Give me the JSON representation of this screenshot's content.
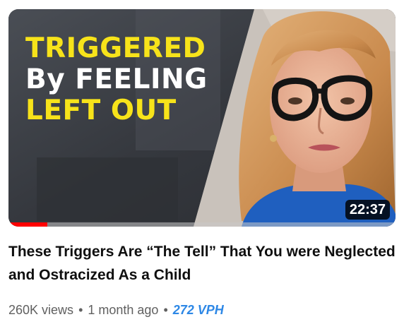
{
  "video": {
    "thumbnail_lines": [
      "TRIGGERED",
      "By FEELING",
      "LEFT OUT"
    ],
    "duration": "22:37",
    "watch_progress": 0.1,
    "title": "These Triggers Are “The Tell” That You were Neglected and Ostracized As a Child",
    "views": "260K views",
    "separator": "•",
    "published": "1 month ago",
    "vph": "272 VPH"
  },
  "colors": {
    "thumbnail_yellow": "#f7e31a",
    "progress_red": "#ff0000",
    "vph_blue": "#2e88e6"
  }
}
